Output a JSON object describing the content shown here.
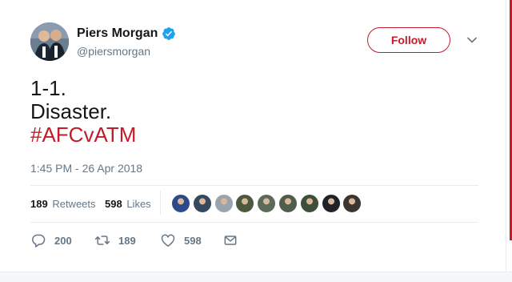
{
  "user": {
    "display_name": "Piers Morgan",
    "screen_name": "@piersmorgan",
    "verified": true
  },
  "follow": {
    "label": "Follow"
  },
  "tweet": {
    "lines": [
      "1-1.",
      "Disaster.",
      "#AFCvATM"
    ],
    "timestamp": "1:45 PM - 26 Apr 2018"
  },
  "stats": {
    "retweets_count": "189",
    "retweets_label": "Retweets",
    "likes_count": "598",
    "likes_label": "Likes"
  },
  "liker_avatar_colors": [
    "#2c4a8a",
    "#35495e",
    "#9aa4ad",
    "#4b5a3c",
    "#5b6b5a",
    "#4f5e4a",
    "#3e4f3a",
    "#1f2328",
    "#3a3530"
  ],
  "actions": {
    "replies": "200",
    "retweets": "189",
    "likes": "598"
  },
  "colors": {
    "accent": "#c21c2a",
    "verified": "#1da1f2",
    "muted": "#657786",
    "text": "#14171a"
  },
  "icons": {
    "verified": "verified-badge-icon",
    "caret": "chevron-down-icon",
    "reply": "reply-icon",
    "retweet": "retweet-icon",
    "like": "heart-icon",
    "dm": "envelope-icon"
  }
}
